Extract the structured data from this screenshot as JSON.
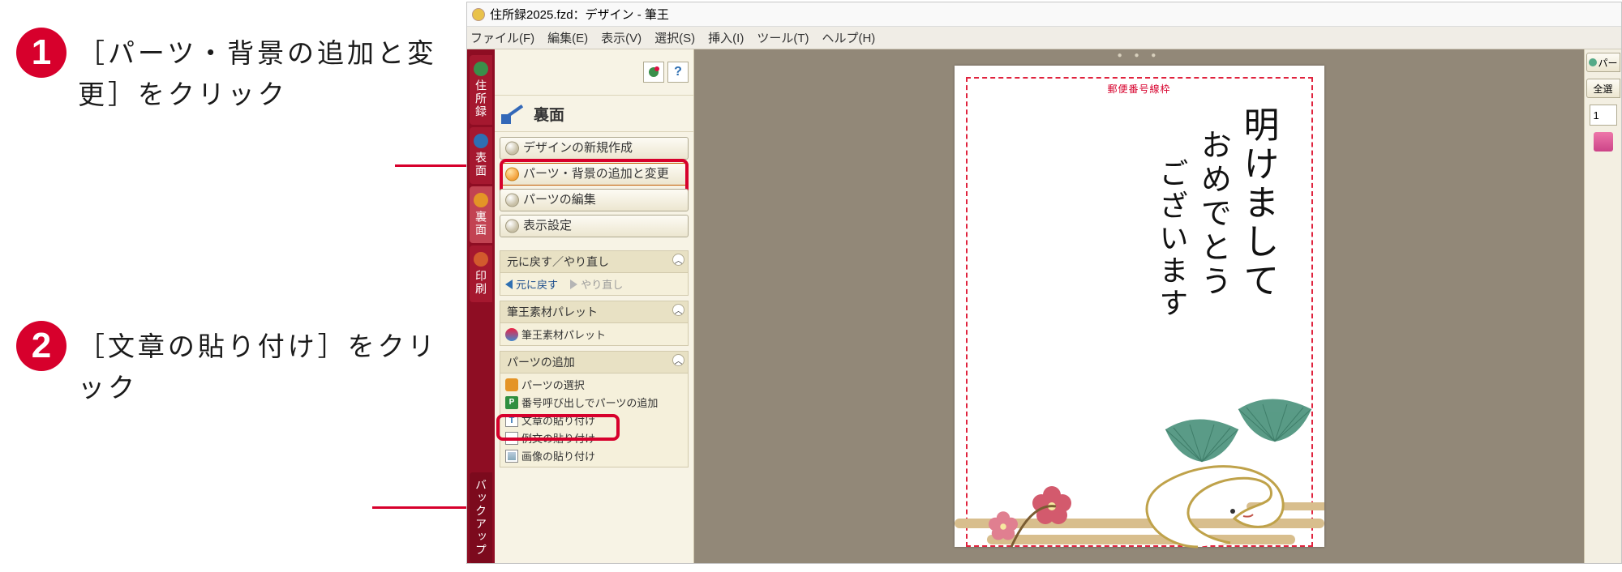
{
  "instructions": {
    "step1": "［パーツ・背景の追加と変更］をクリック",
    "step2": "［文章の貼り付け］をクリック",
    "num1": "1",
    "num2": "2"
  },
  "titlebar": {
    "text": "住所録2025.fzd：デザイン - 筆王"
  },
  "menubar": {
    "file": "ファイル(F)",
    "edit": "編集(E)",
    "view": "表示(V)",
    "select": "選択(S)",
    "insert": "挿入(I)",
    "tool": "ツール(T)",
    "help": "ヘルプ(H)"
  },
  "vtabs": {
    "address": "住所録",
    "front": "表面",
    "back": "裏面",
    "print": "印刷",
    "backup": "バックアップ"
  },
  "panel": {
    "help_q": "?",
    "header": "裏面",
    "btn_new": "デザインの新規作成",
    "btn_parts_bg": "パーツ・背景の追加と変更",
    "btn_parts_edit": "パーツの編集",
    "btn_view": "表示設定"
  },
  "undo": {
    "head": "元に戻す／やり直し",
    "back": "元に戻す",
    "forward": "やり直し"
  },
  "palette": {
    "head": "筆王素材パレット",
    "item": "筆王素材パレット"
  },
  "add_parts": {
    "head": "パーツの追加",
    "sel": "パーツの選択",
    "numcall": "番号呼び出しでパーツの追加",
    "text_paste": "文章の貼り付け",
    "example_paste": "例文の貼り付け",
    "image_paste": "画像の貼り付け"
  },
  "stamp_guide": "郵便番号線枠",
  "rightdock": {
    "tab": "パー",
    "select_all": "全選",
    "one": "1"
  },
  "greeting": {
    "line1": "明けまして",
    "line2": "おめでとう",
    "line3": "ございます"
  }
}
